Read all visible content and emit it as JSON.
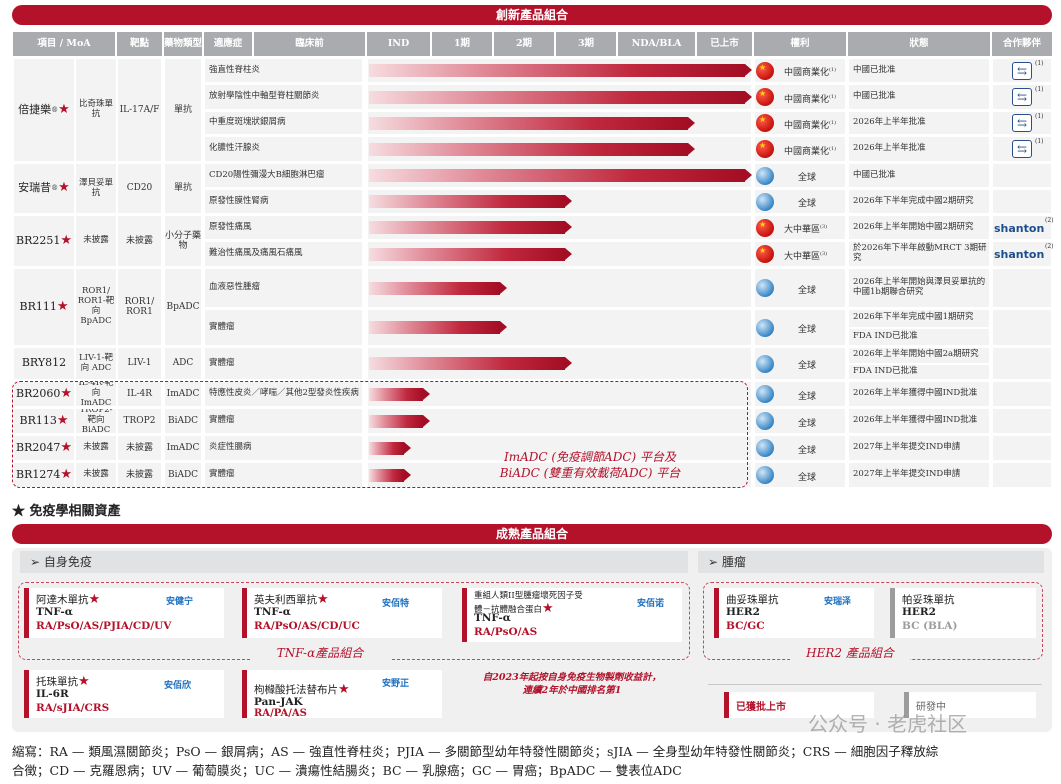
{
  "top_banner": "創新產品組合",
  "headers": [
    "項目 / MoA",
    "靶點",
    "藥物類型",
    "適應症",
    "臨床前",
    "IND",
    "1期",
    "2期",
    "3期",
    "NDA/BLA",
    "已上市",
    "權利",
    "狀態",
    "合作夥伴"
  ],
  "products": [
    {
      "name": "倍捷樂",
      "mark": "®",
      "star": "★",
      "moa": "比奇珠單抗",
      "target": "IL-17A/F",
      "type": "單抗"
    },
    {
      "name": "安瑞昔",
      "mark": "®",
      "star": "★",
      "moa": "澤貝妥單抗",
      "target": "CD20",
      "type": "單抗"
    },
    {
      "name": "BR2251",
      "mark": "",
      "star": "★",
      "moa": "未披露",
      "target": "未披露",
      "type": "小分子藥物"
    },
    {
      "name": "BR111",
      "mark": "",
      "star": "★",
      "moa": "ROR1/ ROR1-靶向 BpADC",
      "target": "ROR1/ ROR1",
      "type": "BpADC"
    },
    {
      "name": "BRY812",
      "mark": "",
      "star": "",
      "moa": "LIV-1-靶向 ADC",
      "target": "LIV-1",
      "type": "ADC"
    },
    {
      "name": "BR2060",
      "mark": "",
      "star": "★",
      "moa": "IL-4R-靶向 ImADC",
      "target": "IL-4R",
      "type": "ImADC"
    },
    {
      "name": "BR113",
      "mark": "",
      "star": "★",
      "moa": "TROP2-靶向 BiADC",
      "target": "TROP2",
      "type": "BiADC"
    },
    {
      "name": "BR2047",
      "mark": "",
      "star": "★",
      "moa": "未披露",
      "target": "未披露",
      "type": "ImADC"
    },
    {
      "name": "BR1274",
      "mark": "",
      "star": "★",
      "moa": "未披露",
      "target": "未披露",
      "type": "BiADC"
    }
  ],
  "rows": [
    {
      "indication": "強直性脊柱炎",
      "stage": 1.0,
      "rights": "中國商業化",
      "rsup": "(1)",
      "region": "cn",
      "status": "中國已批准",
      "partner": "box",
      "psup": "(1)"
    },
    {
      "indication": "放射學陰性中軸型脊柱關節炎",
      "stage": 1.0,
      "rights": "中國商業化",
      "rsup": "(1)",
      "region": "cn",
      "status": "中國已批准",
      "partner": "box",
      "psup": "(1)"
    },
    {
      "indication": "中重度斑塊狀銀屑病",
      "stage": 0.85,
      "rights": "中國商業化",
      "rsup": "(1)",
      "region": "cn",
      "status": "2026年上半年批准",
      "partner": "box",
      "psup": "(1)"
    },
    {
      "indication": "化膿性汗腺炎",
      "stage": 0.85,
      "rights": "中國商業化",
      "rsup": "(1)",
      "region": "cn",
      "status": "2026年上半年批准",
      "partner": "box",
      "psup": "(1)"
    },
    {
      "indication": "CD20陽性彌漫大B細胞淋巴瘤",
      "stage": 1.0,
      "rights": "全球",
      "rsup": "",
      "region": "gl",
      "status": "中國已批准",
      "partner": "",
      "psup": ""
    },
    {
      "indication": "原發性膜性腎病",
      "stage": 0.53,
      "rights": "全球",
      "rsup": "",
      "region": "gl",
      "status": "2026年下半年完成中國2期研究",
      "partner": "",
      "psup": ""
    },
    {
      "indication": "原發性痛風",
      "stage": 0.53,
      "rights": "大中華區",
      "rsup": "(3)",
      "region": "cn",
      "status": "2026年上半年開始中國2期研究",
      "partner": "shanton",
      "psup": "(2)"
    },
    {
      "indication": "難治性痛風及痛風石痛風",
      "stage": 0.53,
      "rights": "大中華區",
      "rsup": "(3)",
      "region": "cn",
      "status": "於2026年下半年啟動MRCT 3期研究",
      "partner": "shanton",
      "psup": "(2)"
    },
    {
      "indication": "血液惡性腫瘤",
      "stage": 0.36,
      "rights": "全球",
      "rsup": "",
      "region": "gl",
      "status": "2026年上半年開始與澤貝妥單抗的中國1b期聯合研究",
      "partner": "",
      "psup": ""
    },
    {
      "indication": "實體瘤",
      "stage": 0.36,
      "rights": "全球",
      "rsup": "",
      "region": "gl",
      "status": "2026年下半年完成中國1期研究",
      "status2": "FDA IND已批准",
      "partner": "",
      "psup": ""
    },
    {
      "indication": "實體瘤",
      "stage": 0.53,
      "rights": "全球",
      "rsup": "",
      "region": "gl",
      "status": "2026年上半年開始中國2a期研究",
      "status2": "FDA IND已批准",
      "partner": "",
      "psup": ""
    },
    {
      "indication": "特應性皮炎／哮喘／其他2型發炎性疾病",
      "stage": 0.16,
      "rights": "全球",
      "rsup": "",
      "region": "gl",
      "status": "2026年上半年獲得中國IND批准",
      "partner": "",
      "psup": ""
    },
    {
      "indication": "實體瘤",
      "stage": 0.16,
      "rights": "全球",
      "rsup": "",
      "region": "gl",
      "status": "2026年上半年獲得中國IND批准",
      "partner": "",
      "psup": ""
    },
    {
      "indication": "炎症性腸病",
      "stage": 0.11,
      "rights": "全球",
      "rsup": "",
      "region": "gl",
      "status": "2027年上半年提交IND申請",
      "partner": "",
      "psup": ""
    },
    {
      "indication": "實體瘤",
      "stage": 0.11,
      "rights": "全球",
      "rsup": "",
      "region": "gl",
      "status": "2027年上半年提交IND申請",
      "partner": "",
      "psup": ""
    }
  ],
  "partner_shanton": "shanton",
  "platform_text": [
    "ImADC (免疫調節ADC) 平台及",
    "BiADC (雙重有效載荷ADC) 平台"
  ],
  "immunology_note": "★ 免疫學相關資產",
  "mature_banner": "成熟產品組合",
  "autoimmune": {
    "title": "➢ 自身免疫",
    "tnf_caption": "TNF-α產品組合",
    "cards": [
      {
        "name": "阿達木單抗",
        "star": "★",
        "target": "TNF-α",
        "ind": "RA/PsO/AS/PJIA/CD/UV",
        "logo": "安健宁"
      },
      {
        "name": "英夫利西單抗",
        "star": "★",
        "target": "TNF-α",
        "ind": "RA/PsO/AS/CD/UC",
        "logo": "安佰特"
      },
      {
        "name": "重組人類II型腫瘤壞死因子受體－抗體融合蛋白",
        "star": "★",
        "target": "TNF-α",
        "ind": "RA/PsO/AS",
        "logo": "安佰诺"
      },
      {
        "name": "托珠單抗",
        "star": "★",
        "target": "IL-6R",
        "ind": "RA/sJIA/CRS",
        "logo": "安佰欣"
      },
      {
        "name": "枸櫞酸托法替布片",
        "star": "★",
        "target": "Pan-JAK",
        "ind": "RA/PA/AS",
        "logo": "安野正"
      }
    ],
    "rank_text": [
      "自2023年起按自身免疫生物製劑收益計，",
      "連續2年於中國排名第1"
    ]
  },
  "oncology": {
    "title": "➢ 腫瘤",
    "her2_caption": "HER2 產品組合",
    "cards": [
      {
        "name": "曲妥珠單抗",
        "target": "HER2",
        "ind": "BC/GC",
        "logo": "安瑞泽"
      },
      {
        "name": "帕妥珠單抗",
        "target": "HER2",
        "ind": "BC (BLA)"
      }
    ],
    "legend": {
      "approved": "已獲批上市",
      "research": "研發中"
    }
  },
  "abbr": [
    "縮寫：RA — 類風濕關節炎；PsO — 銀屑病；AS — 強直性脊柱炎；PJIA — 多關節型幼年特發性關節炎；sJIA — 全身型幼年特發性關節炎；CRS — 細胞因子釋放綜",
    "合徵；CD — 克羅恩病；UV — 葡萄膜炎；UC — 潰瘍性結腸炎；BC — 乳腺癌；GC — 胃癌；BpADC — 雙表位ADC"
  ],
  "watermark": "公众号 · 老虎社区"
}
